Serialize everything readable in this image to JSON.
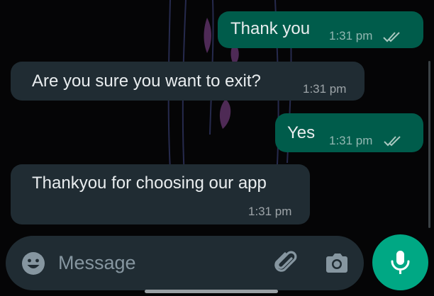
{
  "messages": [
    {
      "direction": "outgoing",
      "text": "Thank you",
      "time": "1:31 pm",
      "status_icon": "double-check-icon"
    },
    {
      "direction": "incoming",
      "text": "Are you sure you want to exit?",
      "time": "1:31 pm"
    },
    {
      "direction": "outgoing",
      "text": "Yes",
      "time": "1:31 pm",
      "status_icon": "double-check-icon"
    },
    {
      "direction": "incoming",
      "text": "Thankyou for choosing our app",
      "time": "1:31 pm"
    }
  ],
  "composer": {
    "placeholder": "Message",
    "emoji_icon": "emoji-icon",
    "attach_icon": "paperclip-icon",
    "camera_icon": "camera-icon"
  },
  "send_button": {
    "icon": "microphone-icon",
    "color": "#00a884"
  },
  "colors": {
    "outgoing_bubble": "#005c4b",
    "incoming_bubble": "#202c33",
    "background": "#050506"
  }
}
